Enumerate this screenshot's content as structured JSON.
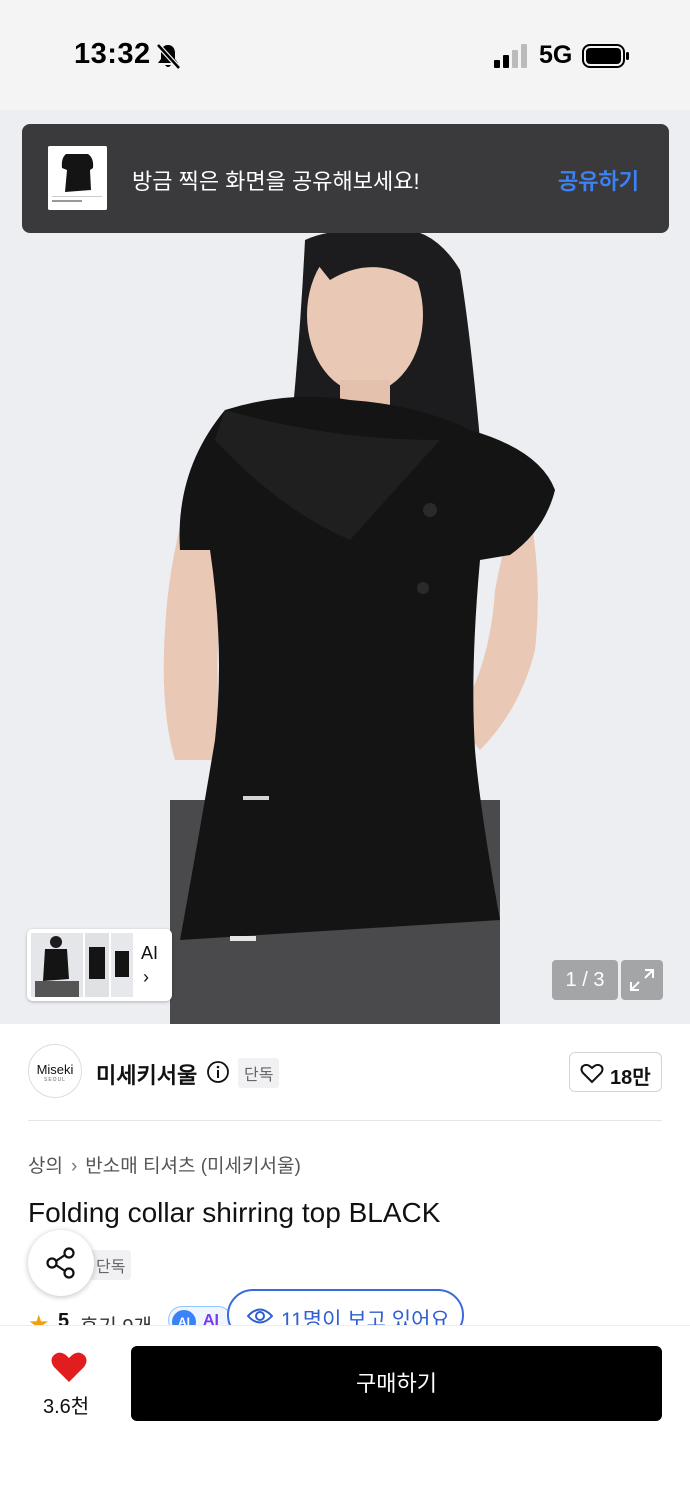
{
  "status_bar": {
    "time": "13:32",
    "network": "5G"
  },
  "toast": {
    "message": "방금 찍은 화면을 공유해보세요!",
    "action": "공유하기"
  },
  "gallery": {
    "ai_label": "AI",
    "ai_chevron": "›",
    "counter": "1 / 3"
  },
  "brand": {
    "logo_text": "Miseki",
    "logo_sub": "SEOUL",
    "name": "미세키서울",
    "exclusive_badge": "단독",
    "likes": "18만"
  },
  "breadcrumb": {
    "category": "상의",
    "separator": "›",
    "subcategory": "반소매 티셔츠 (미세키서울)"
  },
  "product": {
    "title": "Folding collar shirring top BLACK",
    "exclusive_badge": "단독",
    "rating": "5",
    "reviews": "후기 9개",
    "ai_badge": "AI",
    "viewers": "11명이 보고 있어요"
  },
  "bottom_bar": {
    "wishlist_count": "3.6천",
    "buy_label": "구매하기"
  },
  "colors": {
    "accent_blue": "#3b6bd8",
    "toast_bg": "#3a3a3c",
    "heart_red": "#e11d1d",
    "star": "#f59e0b"
  }
}
